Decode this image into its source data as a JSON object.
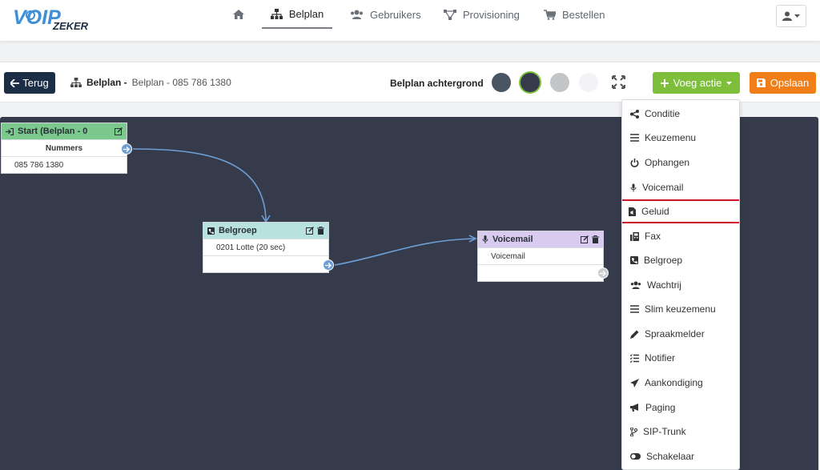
{
  "nav": {
    "logo_text": "VOIP",
    "logo_sub": "ZEKER",
    "items": [
      {
        "label": "",
        "icon": "home-icon"
      },
      {
        "label": "Belplan",
        "icon": "sitemap-icon",
        "active": true
      },
      {
        "label": "Gebruikers",
        "icon": "users-icon"
      },
      {
        "label": "Provisioning",
        "icon": "network-icon"
      },
      {
        "label": "Bestellen",
        "icon": "cart-icon"
      }
    ],
    "user_icon": "user-icon"
  },
  "toolbar": {
    "back_label": "Terug",
    "crumb_bold": "Belplan -",
    "crumb_text": "Belplan - 085 786 1380",
    "bg_label": "Belplan achtergrond",
    "swatches": [
      "#4a5563",
      "#363b4b",
      "#c3c5c8",
      "#f1f3f6"
    ],
    "add_label": "Voeg actie",
    "save_label": "Opslaan",
    "colors": {
      "back": "#1c2e45",
      "add": "#7dbf3b",
      "save": "#f07f1a"
    }
  },
  "nodes": {
    "start": {
      "title": "Start (Belplan - 0",
      "header_label": "Nummers",
      "row": "085 786 1380",
      "color": "#7cc98e"
    },
    "belgroep": {
      "title": "Belgroep",
      "row": "0201 Lotte (20 sec)",
      "color": "#b8e2df"
    },
    "voicemail": {
      "title": "Voicemail",
      "row": "Voicemail",
      "color": "#d9cbef"
    }
  },
  "menu": {
    "items": [
      {
        "label": "Conditie",
        "icon": "share-icon"
      },
      {
        "label": "Keuzemenu",
        "icon": "list-icon"
      },
      {
        "label": "Ophangen",
        "icon": "power-icon"
      },
      {
        "label": "Voicemail",
        "icon": "microphone-icon"
      },
      {
        "label": "Geluid",
        "icon": "file-audio-icon",
        "highlighted": true
      },
      {
        "label": "Fax",
        "icon": "fax-icon"
      },
      {
        "label": "Belgroep",
        "icon": "phone-square-icon"
      },
      {
        "label": "Wachtrij",
        "icon": "users-icon"
      },
      {
        "label": "Slim keuzemenu",
        "icon": "list-icon"
      },
      {
        "label": "Spraakmelder",
        "icon": "pen-icon"
      },
      {
        "label": "Notifier",
        "icon": "tasks-icon"
      },
      {
        "label": "Aankondiging",
        "icon": "paper-plane-icon"
      },
      {
        "label": "Paging",
        "icon": "bullhorn-icon"
      },
      {
        "label": "SIP-Trunk",
        "icon": "code-branch-icon"
      },
      {
        "label": "Schakelaar",
        "icon": "toggle-icon"
      }
    ],
    "highlight_color": "#d0142a"
  }
}
